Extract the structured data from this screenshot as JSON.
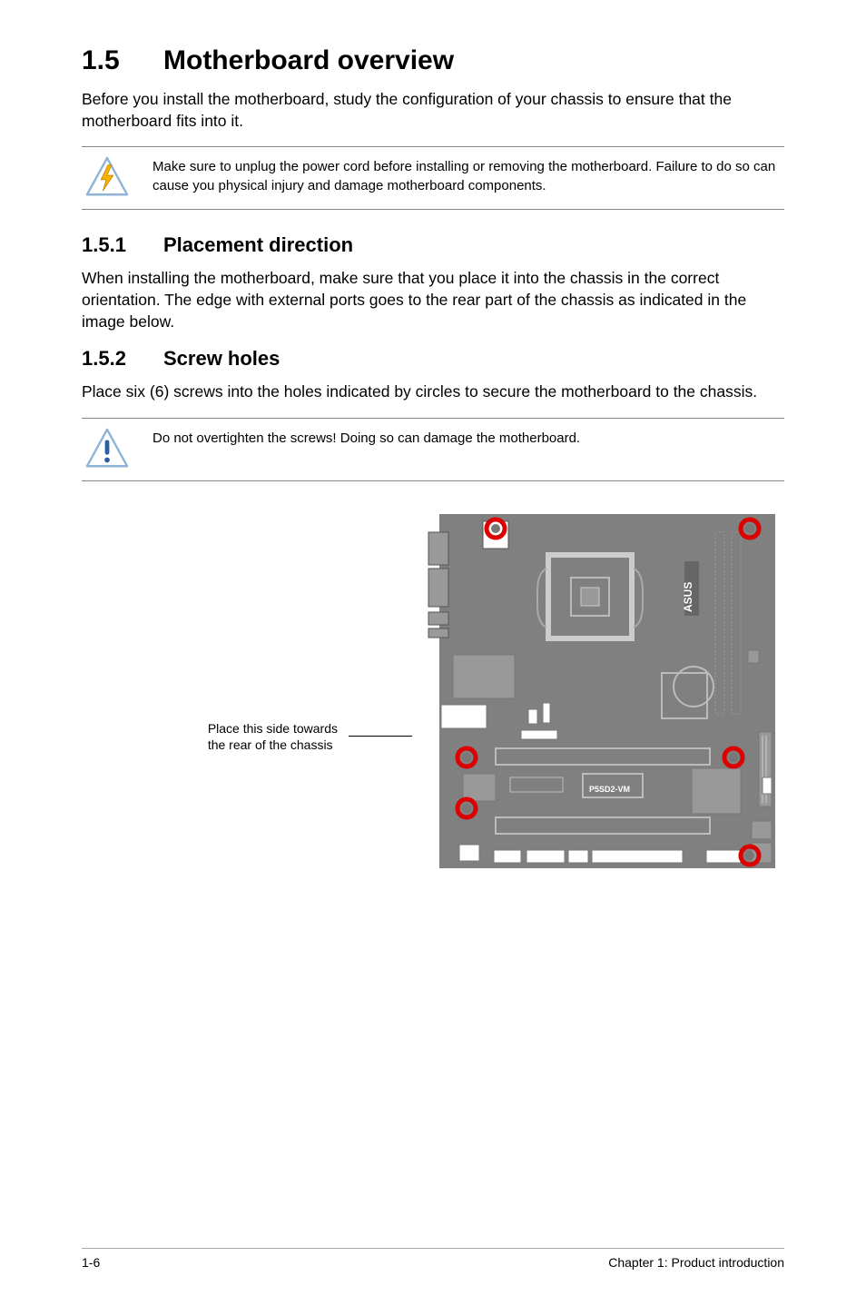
{
  "section": {
    "number": "1.5",
    "title": "Motherboard overview",
    "intro": "Before you install the motherboard, study the configuration of your chassis to ensure that the motherboard fits into it."
  },
  "warning1": "Make sure to unplug the power cord before installing or removing the motherboard. Failure to do so can cause you physical injury and damage motherboard components.",
  "sub1": {
    "number": "1.5.1",
    "title": "Placement direction",
    "text": "When installing the motherboard, make sure that you place it into the chassis in the correct orientation. The edge with external ports goes to the rear part of the chassis as indicated in the image below."
  },
  "sub2": {
    "number": "1.5.2",
    "title": "Screw holes",
    "text": "Place six (6) screws into the holes indicated by circles to secure the motherboard to the chassis."
  },
  "caution1": "Do not overtighten the screws! Doing so can damage the motherboard.",
  "diagram": {
    "side_label_line1": "Place this side towards",
    "side_label_line2": "the rear of the chassis",
    "board_name": "P5SD2-VM"
  },
  "footer": {
    "left": "1-6",
    "right": "Chapter 1: Product introduction"
  }
}
